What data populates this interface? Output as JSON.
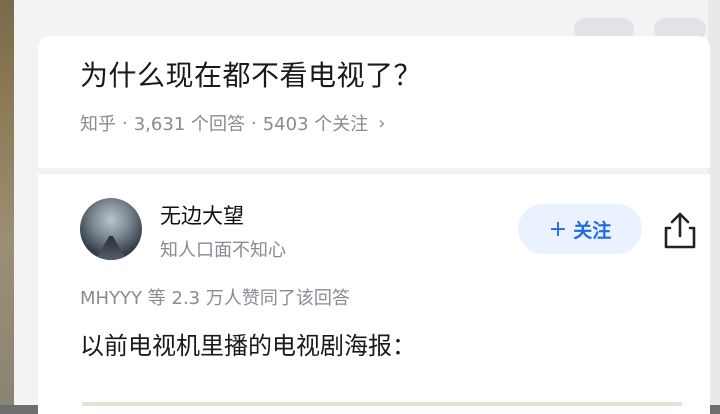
{
  "question": {
    "title": "为什么现在都不看电视了？",
    "source": "知乎",
    "answers_count": "3,631 个回答",
    "followers_count": "5403 个关注",
    "chevron": "›"
  },
  "answer": {
    "author": {
      "name": "无边大望",
      "bio": "知人口面不知心"
    },
    "follow_button": {
      "plus": "+",
      "label": "关注"
    },
    "upvote_text": "MHYYY 等 2.3 万人赞同了该回答",
    "body_text": "以前电视机里播的电视剧海报："
  },
  "icons": [
    "share-icon",
    "plus-icon",
    "chevron-right-icon"
  ],
  "colors": {
    "accent": "#1f6ae6",
    "follow_bg": "#ebf2ff",
    "meta_text": "#8a8a92"
  }
}
